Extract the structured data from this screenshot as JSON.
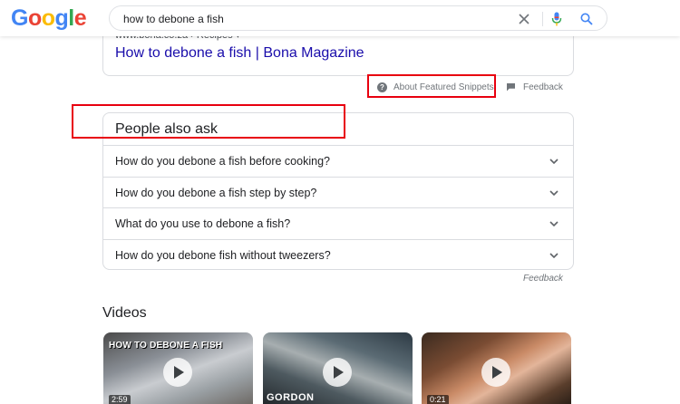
{
  "logo": {
    "letters": [
      "G",
      "o",
      "o",
      "g",
      "l",
      "e"
    ],
    "colors": [
      "#4285f4",
      "#ea4335",
      "#fbbc05",
      "#4285f4",
      "#34a853",
      "#ea4335"
    ]
  },
  "search": {
    "value": "how to debone a fish",
    "icons": [
      "close-icon",
      "mic-icon",
      "search-icon"
    ]
  },
  "featured_snippet": {
    "breadcrumb": "www.bona.co.za › Recipes ▾",
    "title": "How to debone a fish | Bona Magazine",
    "about_label": "About Featured Snippets",
    "feedback_label": "Feedback"
  },
  "people_also_ask": {
    "title": "People also ask",
    "questions": [
      "How do you debone a fish before cooking?",
      "How do you debone a fish step by step?",
      "What do you use to debone a fish?",
      "How do you debone fish without tweezers?"
    ],
    "feedback_label": "Feedback"
  },
  "videos": {
    "heading": "Videos",
    "items": [
      {
        "overlay_text": "HOW TO DEBONE A FISH",
        "duration": "2:59"
      },
      {
        "overlay_text": "GORDON",
        "duration": ""
      },
      {
        "overlay_text": "",
        "duration": "0:21"
      }
    ]
  },
  "colors": {
    "link": "#1a0dab",
    "annotation": "#e8000f",
    "muted": "#70757a"
  }
}
